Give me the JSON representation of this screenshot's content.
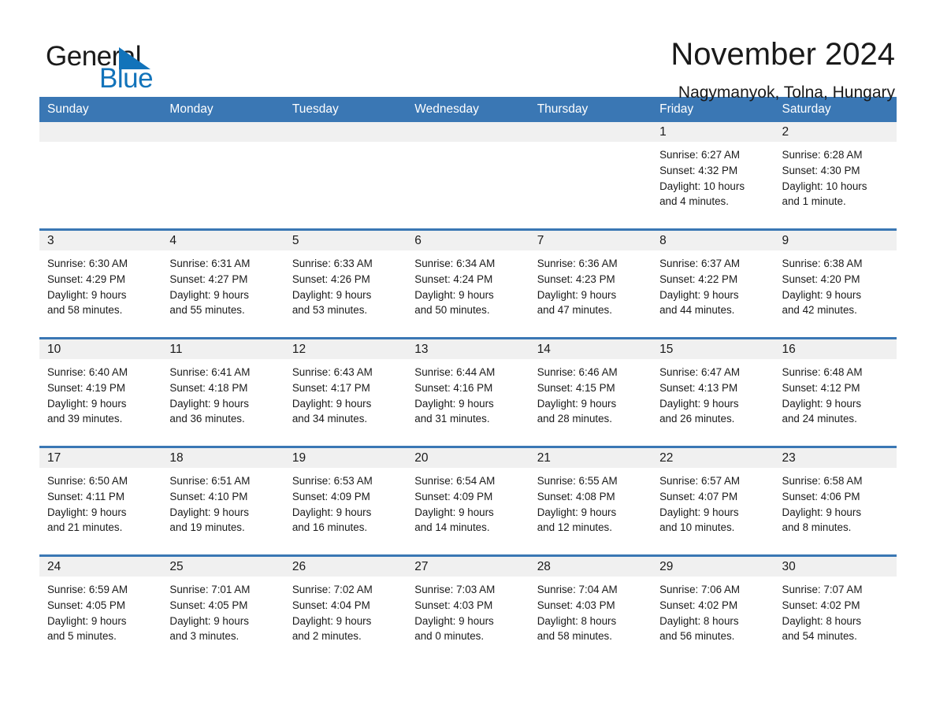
{
  "brand": {
    "name_part1": "General",
    "name_part2": "Blue",
    "triangle_color": "#1273ba",
    "blue_color": "#1273ba"
  },
  "header": {
    "title": "November 2024",
    "subtitle": "Nagymanyok, Tolna, Hungary"
  },
  "theme": {
    "header_blue": "#3a77b4",
    "daynum_band": "#f0f0f0",
    "text": "#1a1a1a"
  },
  "weekday_headers": [
    "Sunday",
    "Monday",
    "Tuesday",
    "Wednesday",
    "Thursday",
    "Friday",
    "Saturday"
  ],
  "weeks": [
    [
      {
        "day": "",
        "sunrise": "",
        "sunset": "",
        "daylight1": "",
        "daylight2": "",
        "empty": true
      },
      {
        "day": "",
        "sunrise": "",
        "sunset": "",
        "daylight1": "",
        "daylight2": "",
        "empty": true
      },
      {
        "day": "",
        "sunrise": "",
        "sunset": "",
        "daylight1": "",
        "daylight2": "",
        "empty": true
      },
      {
        "day": "",
        "sunrise": "",
        "sunset": "",
        "daylight1": "",
        "daylight2": "",
        "empty": true
      },
      {
        "day": "",
        "sunrise": "",
        "sunset": "",
        "daylight1": "",
        "daylight2": "",
        "empty": true
      },
      {
        "day": "1",
        "sunrise": "Sunrise: 6:27 AM",
        "sunset": "Sunset: 4:32 PM",
        "daylight1": "Daylight: 10 hours",
        "daylight2": "and 4 minutes."
      },
      {
        "day": "2",
        "sunrise": "Sunrise: 6:28 AM",
        "sunset": "Sunset: 4:30 PM",
        "daylight1": "Daylight: 10 hours",
        "daylight2": "and 1 minute."
      }
    ],
    [
      {
        "day": "3",
        "sunrise": "Sunrise: 6:30 AM",
        "sunset": "Sunset: 4:29 PM",
        "daylight1": "Daylight: 9 hours",
        "daylight2": "and 58 minutes."
      },
      {
        "day": "4",
        "sunrise": "Sunrise: 6:31 AM",
        "sunset": "Sunset: 4:27 PM",
        "daylight1": "Daylight: 9 hours",
        "daylight2": "and 55 minutes."
      },
      {
        "day": "5",
        "sunrise": "Sunrise: 6:33 AM",
        "sunset": "Sunset: 4:26 PM",
        "daylight1": "Daylight: 9 hours",
        "daylight2": "and 53 minutes."
      },
      {
        "day": "6",
        "sunrise": "Sunrise: 6:34 AM",
        "sunset": "Sunset: 4:24 PM",
        "daylight1": "Daylight: 9 hours",
        "daylight2": "and 50 minutes."
      },
      {
        "day": "7",
        "sunrise": "Sunrise: 6:36 AM",
        "sunset": "Sunset: 4:23 PM",
        "daylight1": "Daylight: 9 hours",
        "daylight2": "and 47 minutes."
      },
      {
        "day": "8",
        "sunrise": "Sunrise: 6:37 AM",
        "sunset": "Sunset: 4:22 PM",
        "daylight1": "Daylight: 9 hours",
        "daylight2": "and 44 minutes."
      },
      {
        "day": "9",
        "sunrise": "Sunrise: 6:38 AM",
        "sunset": "Sunset: 4:20 PM",
        "daylight1": "Daylight: 9 hours",
        "daylight2": "and 42 minutes."
      }
    ],
    [
      {
        "day": "10",
        "sunrise": "Sunrise: 6:40 AM",
        "sunset": "Sunset: 4:19 PM",
        "daylight1": "Daylight: 9 hours",
        "daylight2": "and 39 minutes."
      },
      {
        "day": "11",
        "sunrise": "Sunrise: 6:41 AM",
        "sunset": "Sunset: 4:18 PM",
        "daylight1": "Daylight: 9 hours",
        "daylight2": "and 36 minutes."
      },
      {
        "day": "12",
        "sunrise": "Sunrise: 6:43 AM",
        "sunset": "Sunset: 4:17 PM",
        "daylight1": "Daylight: 9 hours",
        "daylight2": "and 34 minutes."
      },
      {
        "day": "13",
        "sunrise": "Sunrise: 6:44 AM",
        "sunset": "Sunset: 4:16 PM",
        "daylight1": "Daylight: 9 hours",
        "daylight2": "and 31 minutes."
      },
      {
        "day": "14",
        "sunrise": "Sunrise: 6:46 AM",
        "sunset": "Sunset: 4:15 PM",
        "daylight1": "Daylight: 9 hours",
        "daylight2": "and 28 minutes."
      },
      {
        "day": "15",
        "sunrise": "Sunrise: 6:47 AM",
        "sunset": "Sunset: 4:13 PM",
        "daylight1": "Daylight: 9 hours",
        "daylight2": "and 26 minutes."
      },
      {
        "day": "16",
        "sunrise": "Sunrise: 6:48 AM",
        "sunset": "Sunset: 4:12 PM",
        "daylight1": "Daylight: 9 hours",
        "daylight2": "and 24 minutes."
      }
    ],
    [
      {
        "day": "17",
        "sunrise": "Sunrise: 6:50 AM",
        "sunset": "Sunset: 4:11 PM",
        "daylight1": "Daylight: 9 hours",
        "daylight2": "and 21 minutes."
      },
      {
        "day": "18",
        "sunrise": "Sunrise: 6:51 AM",
        "sunset": "Sunset: 4:10 PM",
        "daylight1": "Daylight: 9 hours",
        "daylight2": "and 19 minutes."
      },
      {
        "day": "19",
        "sunrise": "Sunrise: 6:53 AM",
        "sunset": "Sunset: 4:09 PM",
        "daylight1": "Daylight: 9 hours",
        "daylight2": "and 16 minutes."
      },
      {
        "day": "20",
        "sunrise": "Sunrise: 6:54 AM",
        "sunset": "Sunset: 4:09 PM",
        "daylight1": "Daylight: 9 hours",
        "daylight2": "and 14 minutes."
      },
      {
        "day": "21",
        "sunrise": "Sunrise: 6:55 AM",
        "sunset": "Sunset: 4:08 PM",
        "daylight1": "Daylight: 9 hours",
        "daylight2": "and 12 minutes."
      },
      {
        "day": "22",
        "sunrise": "Sunrise: 6:57 AM",
        "sunset": "Sunset: 4:07 PM",
        "daylight1": "Daylight: 9 hours",
        "daylight2": "and 10 minutes."
      },
      {
        "day": "23",
        "sunrise": "Sunrise: 6:58 AM",
        "sunset": "Sunset: 4:06 PM",
        "daylight1": "Daylight: 9 hours",
        "daylight2": "and 8 minutes."
      }
    ],
    [
      {
        "day": "24",
        "sunrise": "Sunrise: 6:59 AM",
        "sunset": "Sunset: 4:05 PM",
        "daylight1": "Daylight: 9 hours",
        "daylight2": "and 5 minutes."
      },
      {
        "day": "25",
        "sunrise": "Sunrise: 7:01 AM",
        "sunset": "Sunset: 4:05 PM",
        "daylight1": "Daylight: 9 hours",
        "daylight2": "and 3 minutes."
      },
      {
        "day": "26",
        "sunrise": "Sunrise: 7:02 AM",
        "sunset": "Sunset: 4:04 PM",
        "daylight1": "Daylight: 9 hours",
        "daylight2": "and 2 minutes."
      },
      {
        "day": "27",
        "sunrise": "Sunrise: 7:03 AM",
        "sunset": "Sunset: 4:03 PM",
        "daylight1": "Daylight: 9 hours",
        "daylight2": "and 0 minutes."
      },
      {
        "day": "28",
        "sunrise": "Sunrise: 7:04 AM",
        "sunset": "Sunset: 4:03 PM",
        "daylight1": "Daylight: 8 hours",
        "daylight2": "and 58 minutes."
      },
      {
        "day": "29",
        "sunrise": "Sunrise: 7:06 AM",
        "sunset": "Sunset: 4:02 PM",
        "daylight1": "Daylight: 8 hours",
        "daylight2": "and 56 minutes."
      },
      {
        "day": "30",
        "sunrise": "Sunrise: 7:07 AM",
        "sunset": "Sunset: 4:02 PM",
        "daylight1": "Daylight: 8 hours",
        "daylight2": "and 54 minutes."
      }
    ]
  ]
}
